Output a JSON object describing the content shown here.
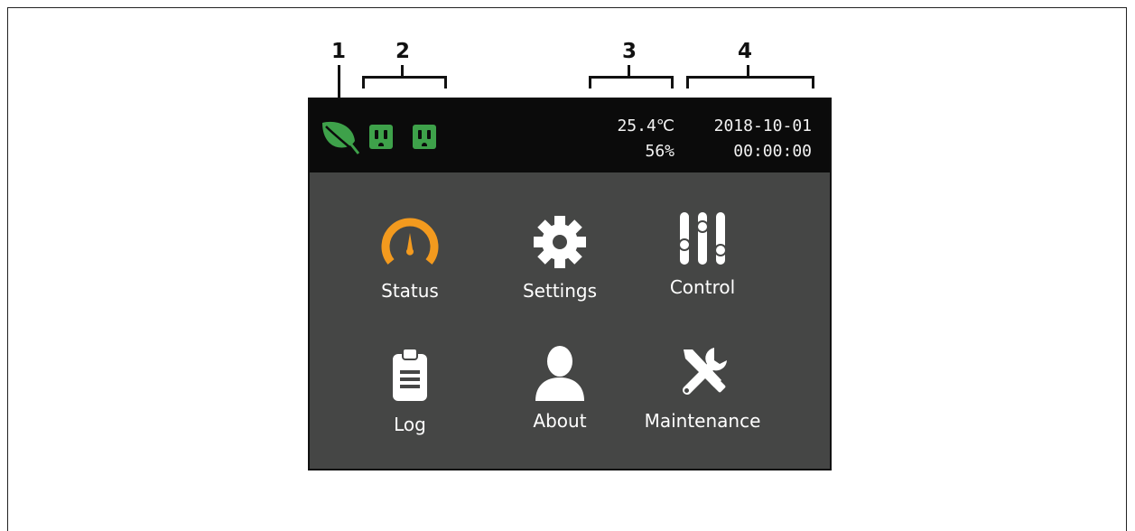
{
  "callouts": [
    "1",
    "2",
    "3",
    "4"
  ],
  "statusbar": {
    "temperature": "25.4℃",
    "humidity": "56%",
    "date": "2018-10-01",
    "time": "00:00:00",
    "icons": [
      "leaf-icon",
      "outlet-icon",
      "outlet-icon"
    ],
    "eco_color": "#3ea14a"
  },
  "menu": {
    "items": [
      {
        "label": "Status",
        "icon": "gauge-icon",
        "icon_color": "#f39a1e"
      },
      {
        "label": "Settings",
        "icon": "gear-icon"
      },
      {
        "label": "Control",
        "icon": "sliders-icon"
      },
      {
        "label": "Log",
        "icon": "clipboard-icon"
      },
      {
        "label": "About",
        "icon": "user-icon"
      },
      {
        "label": "Maintenance",
        "icon": "tools-icon"
      }
    ]
  },
  "colors": {
    "screen_bg": "#454645",
    "statusbar_bg": "#0b0b0b"
  }
}
